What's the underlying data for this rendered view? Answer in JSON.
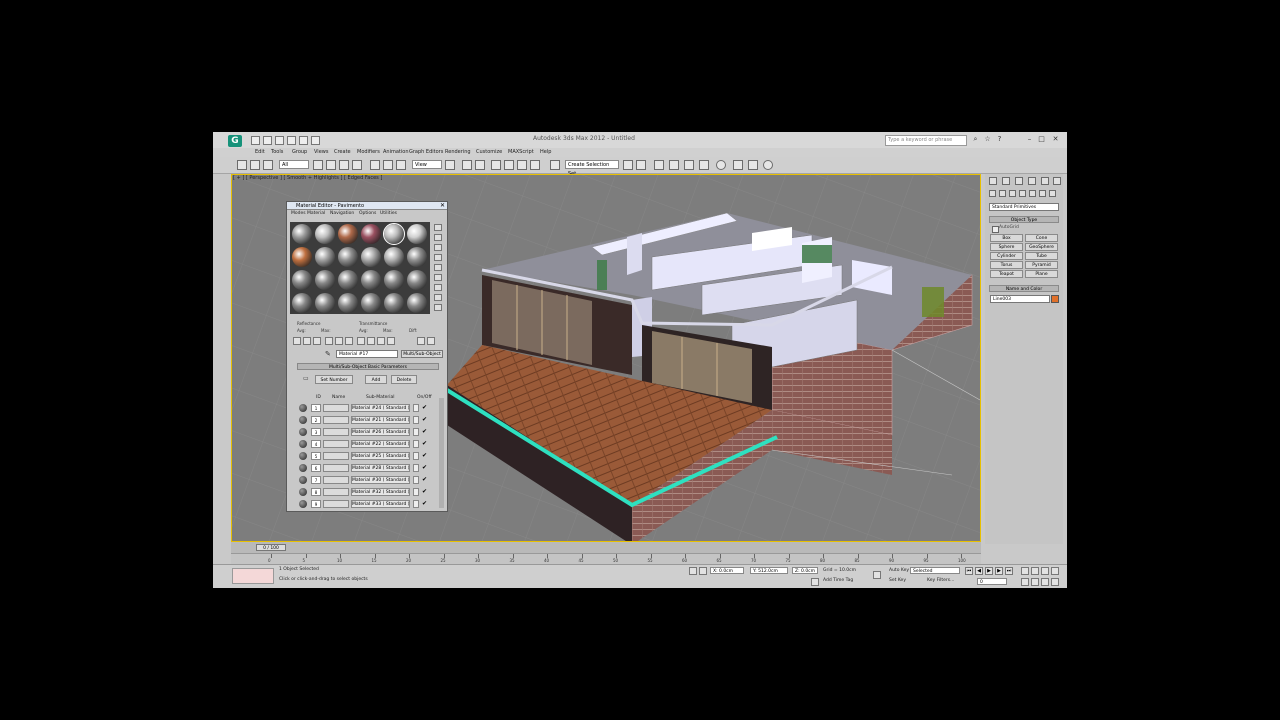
{
  "app": {
    "logo": "G",
    "title": "Autodesk 3ds Max 2012 - Untitled",
    "search_placeholder": "Type a keyword or phrase"
  },
  "menu": [
    "Edit",
    "Tools",
    "Group",
    "Views",
    "Create",
    "Modifiers",
    "Animation",
    "Graph Editors",
    "Rendering",
    "Customize",
    "MAXScript",
    "Help"
  ],
  "toolbar": {
    "selection_filter": "All",
    "ref_coord": "View",
    "named_selection": "Create Selection Set"
  },
  "viewport": {
    "label": "[ + ] [ Perspective ] [ Smooth + Highlights ] [ Edged Faces ]"
  },
  "command_panel": {
    "dropdown": "Standard Primitives",
    "object_type_title": "Object Type",
    "autogrid": "AutoGrid",
    "buttons": [
      "Box",
      "Cone",
      "Sphere",
      "GeoSphere",
      "Cylinder",
      "Tube",
      "Torus",
      "Pyramid",
      "Teapot",
      "Plane"
    ],
    "name_color_title": "Name and Color",
    "object_name": "Line003",
    "color": "#e0702a"
  },
  "timeline": {
    "frame": "0 / 100",
    "ticks": [
      "0",
      "5",
      "10",
      "15",
      "20",
      "25",
      "30",
      "35",
      "40",
      "45",
      "50",
      "55",
      "60",
      "65",
      "70",
      "75",
      "80",
      "85",
      "90",
      "95",
      "100"
    ]
  },
  "status": {
    "selected": "1 Object Selected",
    "prompt": "Click or click-and-drag to select objects",
    "x": "X: 0.0cm",
    "y": "Y: 512.0cm",
    "z": "Z: 0.0cm",
    "grid": "Grid = 10.0cm",
    "add_time_tag": "Add Time Tag",
    "auto_key": "Auto Key",
    "set_key": "Set Key",
    "key_mode": "Selected",
    "key_filters": "Key Filters...",
    "frame_field": "0"
  },
  "material_editor": {
    "title": "Material Editor - Pavimento",
    "menu": [
      "Modes",
      "Material",
      "Navigation",
      "Options",
      "Utilities"
    ],
    "reflectance_label": "Reflectance",
    "transmittance_label": "Transmittance",
    "avg": "Avg:",
    "max": "Max:",
    "diff": "Diff:",
    "material_name": "Material #17",
    "material_type": "Multi/Sub-Object",
    "rollout_title": "Multi/Sub-Object Basic Parameters",
    "set_number": "Set Number",
    "add": "Add",
    "delete": "Delete",
    "col_id": "ID",
    "col_name": "Name",
    "col_submaterial": "Sub-Material",
    "col_onoff": "On/Off",
    "rows": [
      {
        "id": "1",
        "sub": "Material #24 ( Standard )"
      },
      {
        "id": "2",
        "sub": "Material #21 ( Standard )"
      },
      {
        "id": "3",
        "sub": "Material #26 ( Standard )"
      },
      {
        "id": "4",
        "sub": "Material #22 ( Standard )"
      },
      {
        "id": "5",
        "sub": "Material #25 ( Standard )"
      },
      {
        "id": "6",
        "sub": "Material #28 ( Standard )"
      },
      {
        "id": "7",
        "sub": "Material #30 ( Standard )"
      },
      {
        "id": "8",
        "sub": "Material #32 ( Standard )"
      },
      {
        "id": "9",
        "sub": "Material #33 ( Standard )"
      }
    ]
  }
}
